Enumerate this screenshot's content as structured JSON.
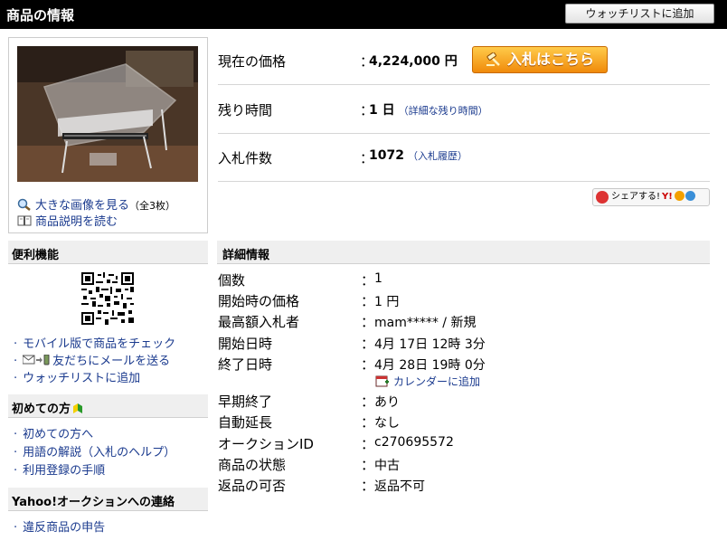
{
  "header": {
    "title": "商品の情報",
    "watchlist_button": "ウォッチリストに追加"
  },
  "image_panel": {
    "enlarge_link": "大きな画像を見る",
    "enlarge_count": "（全3枚）",
    "description_link": "商品説明を読む"
  },
  "price_rows": {
    "price_label": "現在の価格",
    "price_value": "4,224,000 円",
    "bid_button": "入札はこちら",
    "time_label": "残り時間",
    "time_value": "1 日",
    "time_detail_link": "（詳細な残り時間）",
    "bids_label": "入札件数",
    "bids_value": "1072",
    "bids_history_link": "（入札履歴）",
    "colon": "："
  },
  "share": {
    "label": "シェアする!",
    "y_label": "Y!",
    "dots": [
      "ⓜ",
      "ⓗ"
    ]
  },
  "sidebar": {
    "convenience_title": "便利機能",
    "convenience_items": [
      "モバイル版で商品をチェック",
      "友だちにメールを送る",
      "ウォッチリストに追加"
    ],
    "beginner_title": "初めての方",
    "beginner_items": [
      "初めての方へ",
      "用語の解説（入札のヘルプ）",
      "利用登録の手順"
    ],
    "contact_title": "Yahoo!オークションへの連絡",
    "contact_items": [
      "違反商品の申告"
    ]
  },
  "details": {
    "title": "詳細情報",
    "rows": [
      {
        "label": "個数",
        "value": "1"
      },
      {
        "label": "開始時の価格",
        "value": "1 円"
      },
      {
        "label": "最高額入札者",
        "value": "mam***** / 新規"
      },
      {
        "label": "開始日時",
        "value": "4月 17日 12時 3分"
      },
      {
        "label": "終了日時",
        "value": "4月 28日 19時 0分"
      },
      {
        "label": "早期終了",
        "value": "あり"
      },
      {
        "label": "自動延長",
        "value": "なし"
      },
      {
        "label": "オークションID",
        "value": "c270695572"
      },
      {
        "label": "商品の状態",
        "value": "中古"
      },
      {
        "label": "返品の可否",
        "value": "返品不可"
      }
    ],
    "calendar_link": "カレンダーに追加",
    "colon": "："
  },
  "colors": {
    "header_bg": "#000000",
    "link": "#1a3a8e",
    "bid_button": "#f08a0a",
    "section_bg": "#efefef"
  }
}
